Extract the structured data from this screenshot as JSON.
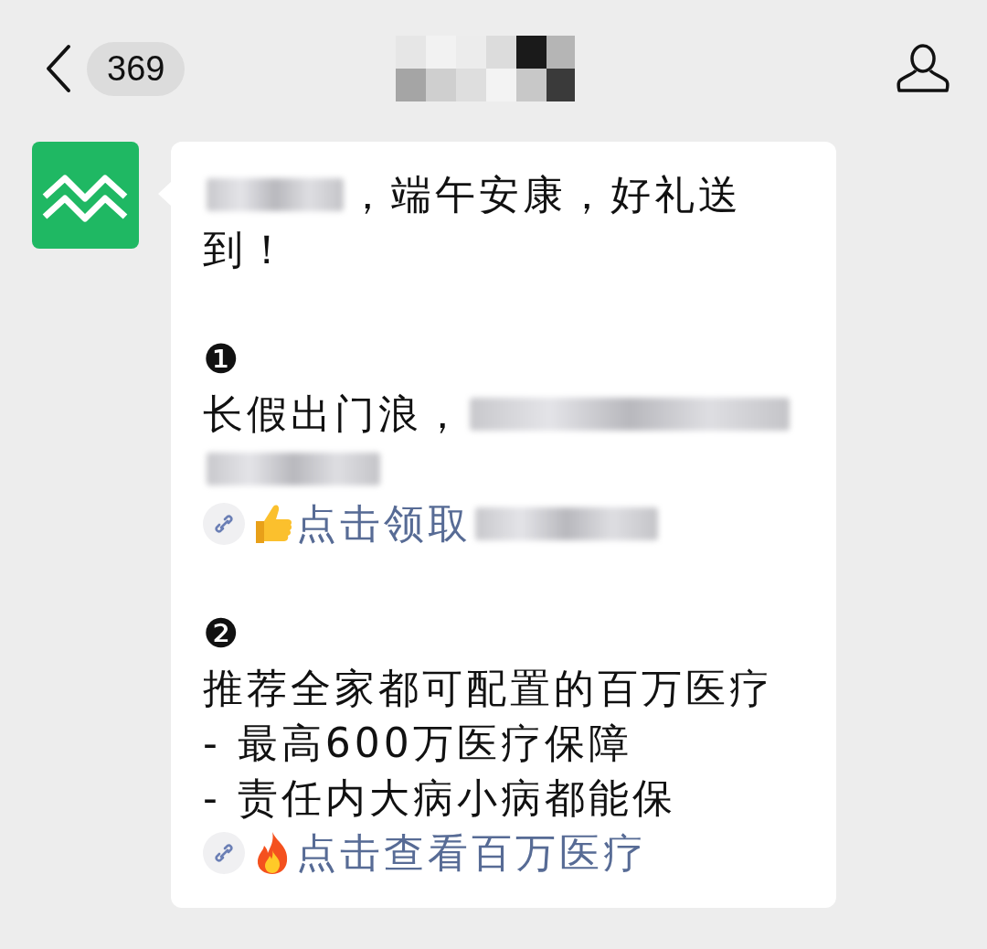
{
  "header": {
    "unread_count": "369",
    "title": {
      "kind": "redacted"
    }
  },
  "message": {
    "lines": [
      {
        "kind": "text",
        "segments": [
          {
            "kind": "redacted"
          },
          {
            "kind": "text",
            "text": "，端午安康，好礼送"
          }
        ]
      },
      {
        "kind": "text",
        "segments": [
          {
            "kind": "text",
            "text": "到！"
          }
        ]
      },
      {
        "kind": "blank"
      },
      {
        "kind": "text",
        "segments": [
          {
            "kind": "text",
            "text": "❶"
          }
        ]
      },
      {
        "kind": "text",
        "segments": [
          {
            "kind": "text",
            "text": "长假出门浪，"
          },
          {
            "kind": "redacted"
          }
        ]
      },
      {
        "kind": "text",
        "segments": [
          {
            "kind": "redacted"
          }
        ]
      },
      {
        "kind": "link",
        "segments": [
          {
            "kind": "thumb"
          },
          {
            "kind": "link",
            "text": "点击领取"
          },
          {
            "kind": "redacted"
          }
        ]
      },
      {
        "kind": "blank"
      },
      {
        "kind": "text",
        "segments": [
          {
            "kind": "text",
            "text": "❷"
          }
        ]
      },
      {
        "kind": "text",
        "segments": [
          {
            "kind": "text",
            "text": "推荐全家都可配置的百万医疗"
          }
        ]
      },
      {
        "kind": "text",
        "segments": [
          {
            "kind": "text",
            "text": "- 最高600万医疗保障"
          }
        ]
      },
      {
        "kind": "text",
        "segments": [
          {
            "kind": "text",
            "text": "- 责任内大病小病都能保"
          }
        ]
      },
      {
        "kind": "link",
        "segments": [
          {
            "kind": "fire"
          },
          {
            "kind": "link",
            "text": "点击查看百万医疗"
          }
        ]
      }
    ]
  }
}
